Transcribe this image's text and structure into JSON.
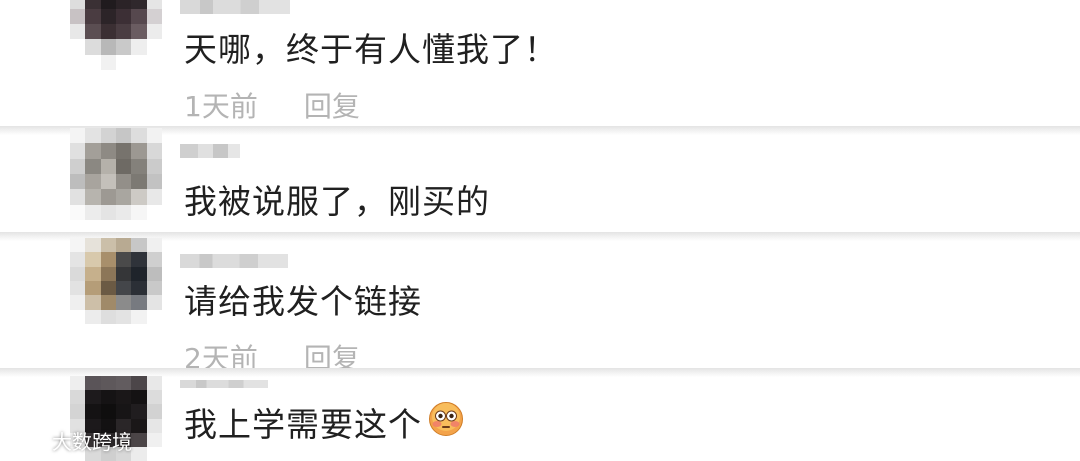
{
  "comments": [
    {
      "text": "天哪，终于有人懂我了！",
      "time": "1天前",
      "reply": "回复"
    },
    {
      "text": "我被说服了，刚买的"
    },
    {
      "text": "请给我发个链接",
      "time": "2天前",
      "reply": "回复"
    },
    {
      "text": "我上学需要这个",
      "emoji": "flushed-face"
    }
  ],
  "watermark": {
    "brand": "大数跨境"
  },
  "colors": {
    "text": "#202020",
    "meta": "#b4b4b4",
    "divider": "#e4e4e4"
  }
}
